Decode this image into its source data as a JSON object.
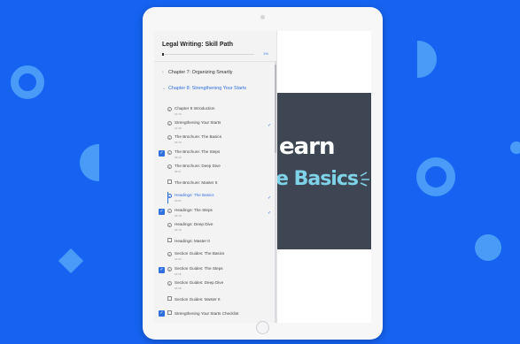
{
  "sidebar": {
    "course_title": "Legal Writing: Skill Path",
    "progress_text": "1%",
    "progress": 0.02,
    "chapters": [
      {
        "label": "Chapter 7: Organizing Smartly",
        "expanded": false
      },
      {
        "label": "Chapter 8: Strengthening Your Starts",
        "expanded": true
      }
    ],
    "lessons": [
      {
        "name": "Chapter 8 Introduction",
        "duration": "01:18",
        "type": "play",
        "checked": false,
        "done": false,
        "current": false
      },
      {
        "name": "Strengthening Your Starts",
        "duration": "01:48",
        "type": "play",
        "checked": false,
        "done": true,
        "current": false
      },
      {
        "name": "The Brochure: The Basics",
        "duration": "03:18",
        "type": "play",
        "checked": false,
        "done": false,
        "current": false
      },
      {
        "name": "The Brochure: The Steps",
        "duration": "05:18",
        "type": "play",
        "checked": true,
        "done": false,
        "current": false
      },
      {
        "name": "The Brochure: Deep Dive",
        "duration": "06:07",
        "type": "play",
        "checked": false,
        "done": false,
        "current": false
      },
      {
        "name": "The Brochure: Master It",
        "duration": "",
        "type": "doc",
        "checked": false,
        "done": false,
        "current": false
      },
      {
        "name": "Headings: The Basics",
        "duration": "00:53",
        "type": "play",
        "checked": false,
        "done": true,
        "current": true
      },
      {
        "name": "Headings: The Steps",
        "duration": "03:18",
        "type": "play",
        "checked": true,
        "done": true,
        "current": false
      },
      {
        "name": "Headings: Deep Dive",
        "duration": "04:18",
        "type": "play",
        "checked": false,
        "done": false,
        "current": false
      },
      {
        "name": "Headings: Master It",
        "duration": "",
        "type": "doc",
        "checked": false,
        "done": false,
        "current": false
      },
      {
        "name": "Section Guides: The Basics",
        "duration": "01:34",
        "type": "play",
        "checked": false,
        "done": false,
        "current": false
      },
      {
        "name": "Section Guides: The Steps",
        "duration": "03:18",
        "type": "play",
        "checked": true,
        "done": false,
        "current": false
      },
      {
        "name": "Section Guides: Deep Dive",
        "duration": "05:28",
        "type": "play",
        "checked": false,
        "done": false,
        "current": false
      },
      {
        "name": "Section Guides: Master It",
        "duration": "",
        "type": "doc",
        "checked": false,
        "done": false,
        "current": false
      },
      {
        "name": "Strengthening Your Starts Checklist",
        "duration": "",
        "type": "doc",
        "checked": true,
        "done": false,
        "current": false
      }
    ]
  },
  "video": {
    "line1": "earn",
    "line2": "e Basics"
  },
  "colors": {
    "background": "#1563f0",
    "accent": "#2f6fe0",
    "video_bg": "#3d4652",
    "video_highlight": "#7fd3e8"
  }
}
